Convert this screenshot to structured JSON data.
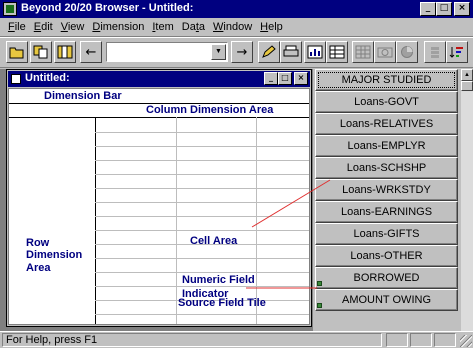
{
  "app": {
    "title": "Beyond 20/20 Browser - Untitled:",
    "title_buttons": {
      "minimize": "_",
      "maximize": "□",
      "close": "×"
    }
  },
  "menu": [
    {
      "label": "File",
      "accel": "F",
      "rest": "ile"
    },
    {
      "label": "Edit",
      "accel": "E",
      "rest": "dit"
    },
    {
      "label": "View",
      "accel": "V",
      "rest": "iew"
    },
    {
      "label": "Dimension",
      "accel": "D",
      "rest": "imension"
    },
    {
      "label": "Item",
      "accel": "I",
      "rest": "tem"
    },
    {
      "label": "Data",
      "accel": "",
      "pre": "Da",
      "accel2": "t",
      "post": "a"
    },
    {
      "label": "Window",
      "accel": "W",
      "rest": "indow"
    },
    {
      "label": "Help",
      "accel": "H",
      "rest": "elp"
    }
  ],
  "toolbar": {
    "icons": [
      "open-icon",
      "copy-icon",
      "layout-icon",
      "back-arrow-icon",
      "forward-arrow-icon",
      "pencil-icon",
      "print-icon",
      "chart-icon",
      "table-icon",
      "grid-icon",
      "camera-icon",
      "pie-icon",
      "bar-chart-icon",
      "sort-icon"
    ],
    "dimension_combo_value": "",
    "dropdown_glyph": "▼",
    "back_glyph": "←",
    "forward_glyph": "→"
  },
  "child_window": {
    "title": "Untitled:"
  },
  "table": {
    "dimension_bar": "Dimension Bar",
    "column_area": "Column Dimension Area",
    "row_area_lines": [
      "Row",
      "Dimension",
      "Area"
    ],
    "cell_area": "Cell Area",
    "source_field_tile": "Source Field Tile",
    "numeric_indicator_lines": [
      "Numeric Field",
      "Indicator"
    ]
  },
  "dimensions": [
    {
      "label": "MAJOR STUDIED",
      "selected": true,
      "numeric": false
    },
    {
      "label": "Loans-GOVT",
      "selected": false,
      "numeric": false
    },
    {
      "label": "Loans-RELATIVES",
      "selected": false,
      "numeric": false
    },
    {
      "label": "Loans-EMPLYR",
      "selected": false,
      "numeric": false
    },
    {
      "label": "Loans-SCHSHP",
      "selected": false,
      "numeric": false
    },
    {
      "label": "Loans-WRKSTDY",
      "selected": false,
      "numeric": false
    },
    {
      "label": "Loans-EARNINGS",
      "selected": false,
      "numeric": false
    },
    {
      "label": "Loans-GIFTS",
      "selected": false,
      "numeric": false
    },
    {
      "label": "Loans-OTHER",
      "selected": false,
      "numeric": false
    },
    {
      "label": "BORROWED",
      "selected": false,
      "numeric": true
    },
    {
      "label": "AMOUNT OWING",
      "selected": false,
      "numeric": true
    }
  ],
  "status": {
    "text": "For Help, press F1"
  },
  "colors": {
    "title_bar": "#000080",
    "annotation_line": "#e03030",
    "numeric_indicator": "#3a8a3a"
  }
}
